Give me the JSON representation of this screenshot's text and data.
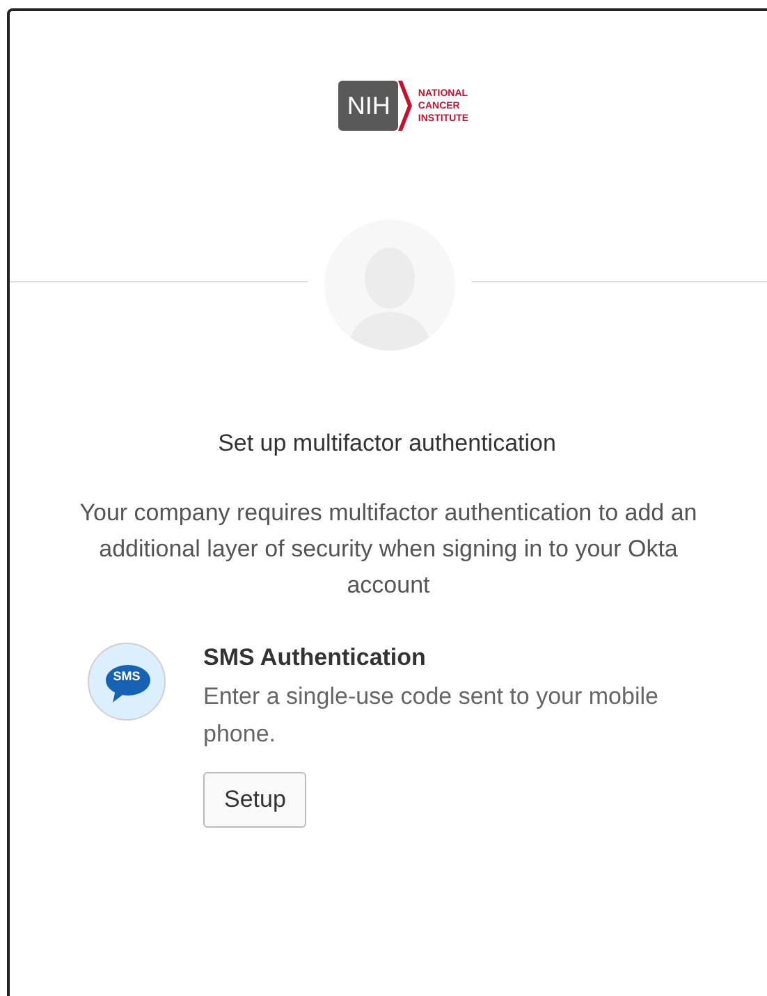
{
  "logo": {
    "mark": "NIH",
    "name_lines": [
      "NATIONAL",
      "CANCER",
      "INSTITUTE"
    ]
  },
  "title": "Set up multifactor authentication",
  "description": "Your company requires multifactor authentication to add an additional layer of security when signing in to your Okta account",
  "factors": [
    {
      "kind": "sms",
      "icon_text": "SMS",
      "name": "SMS Authentication",
      "description": "Enter a single-use code sent to your mobile phone.",
      "button": "Setup"
    }
  ]
}
